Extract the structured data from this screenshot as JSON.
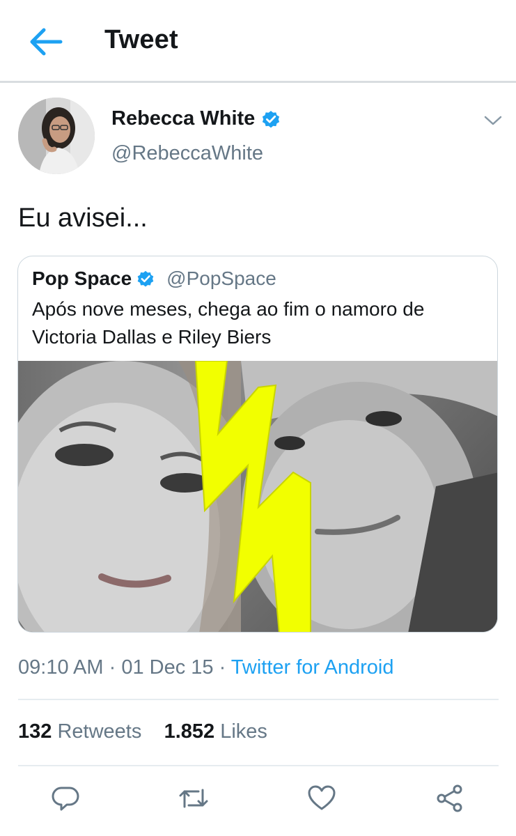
{
  "header": {
    "title": "Tweet"
  },
  "author": {
    "name": "Rebecca White",
    "handle": "@RebeccaWhite"
  },
  "tweet": {
    "text": "Eu avisei..."
  },
  "quote": {
    "name": "Pop Space",
    "handle": "@PopSpace",
    "text": "Após nove meses, chega ao fim o namoro de Victoria Dallas e Riley Biers"
  },
  "meta": {
    "time": "09:10 AM",
    "sep1": " · ",
    "date": "01 Dec 15",
    "sep2": " · ",
    "source": "Twitter for Android"
  },
  "stats": {
    "retweets_count": "132",
    "retweets_label": "Retweets",
    "likes_count": "1.852",
    "likes_label": "Likes"
  },
  "colors": {
    "accent": "#1da1f2",
    "secondary_text": "#657786",
    "bolt": "#f2ff00"
  },
  "icons": [
    "back-arrow-icon",
    "verified-badge-icon",
    "chevron-down-icon",
    "reply-icon",
    "retweet-icon",
    "like-icon",
    "share-icon"
  ]
}
